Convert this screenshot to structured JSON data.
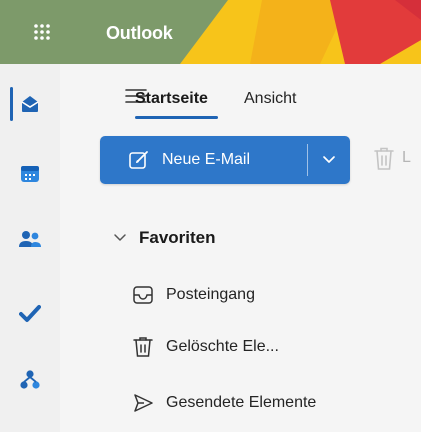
{
  "header": {
    "app_title": "Outlook",
    "colors": {
      "base": "#7d9a6a",
      "gold": "#f7c41a",
      "red": "#e23b3b",
      "accent": "#1f64b4"
    }
  },
  "rail": {
    "items": [
      {
        "name": "mail",
        "icon": "mail-icon",
        "active": true
      },
      {
        "name": "calendar",
        "icon": "calendar-icon",
        "active": false
      },
      {
        "name": "people",
        "icon": "people-icon",
        "active": false
      },
      {
        "name": "todo",
        "icon": "checkmark-icon",
        "active": false
      },
      {
        "name": "org",
        "icon": "org-chart-icon",
        "active": false
      }
    ]
  },
  "ribbon": {
    "menu_icon": "hamburger-icon",
    "tabs": [
      {
        "label": "Startseite",
        "active": true
      },
      {
        "label": "Ansicht",
        "active": false
      }
    ],
    "new_mail_label": "Neue E-Mail",
    "new_mail_icon": "compose-icon",
    "dropdown_icon": "chevron-down-icon",
    "delete_icon": "trash-icon",
    "delete_label_partial": "L"
  },
  "folders": {
    "section_label": "Favoriten",
    "items": [
      {
        "label": "Posteingang",
        "icon": "inbox-icon"
      },
      {
        "label": "Gelöschte Ele...",
        "icon": "trash-icon"
      },
      {
        "label": "Gesendete Elemente",
        "icon": "send-icon"
      }
    ]
  }
}
